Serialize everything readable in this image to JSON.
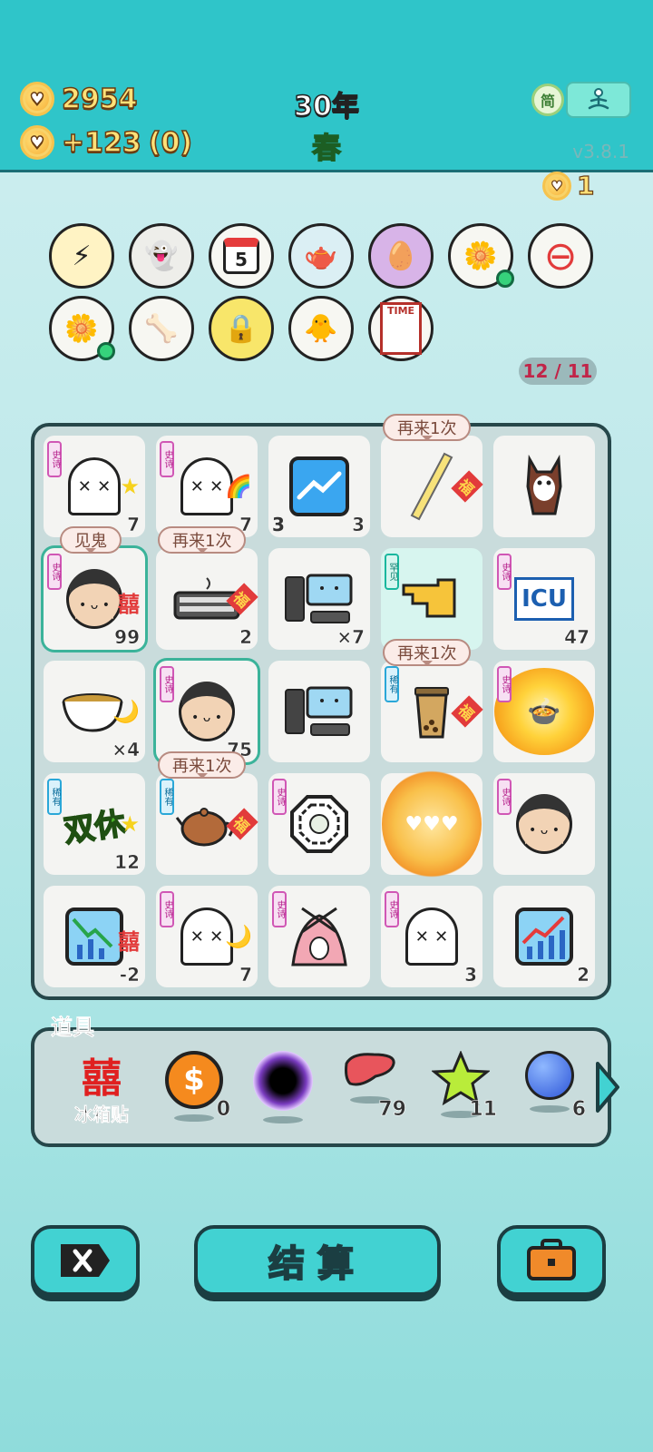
{
  "header": {
    "coins": "2954",
    "income": "+123",
    "income_pending": "(0)",
    "year": "30年",
    "season": "春",
    "version": "v3.8.1",
    "lang_label": "简"
  },
  "mini_coin": "1",
  "board_counter": "12 / 11",
  "buffs": [
    {
      "name": "lightning-icon",
      "glyph": "⚡"
    },
    {
      "name": "ghost-icon",
      "glyph": "👻"
    },
    {
      "name": "calendar-icon",
      "glyph": "5"
    },
    {
      "name": "gravy-boat-icon",
      "glyph": "🫖"
    },
    {
      "name": "egg-bag-icon",
      "glyph": "🥚"
    },
    {
      "name": "flower-pot-icon",
      "glyph": "🌼"
    },
    {
      "name": "minus-icon",
      "glyph": "⊖"
    },
    {
      "name": "flower-pot-icon-2",
      "glyph": "🌼"
    },
    {
      "name": "dog-bowl-icon",
      "glyph": "🦴"
    },
    {
      "name": "safe-icon",
      "glyph": "🔒"
    },
    {
      "name": "chick-syringe-icon",
      "glyph": "🐥"
    },
    {
      "name": "time-magazine-icon",
      "glyph": "TIME"
    }
  ],
  "tags": {
    "epic": "史诗",
    "rare": "稀有",
    "uncommon": "罕见"
  },
  "board": [
    {
      "icon": "ghost",
      "extra": "★",
      "tag": "epic",
      "num": "7"
    },
    {
      "icon": "ghost",
      "extra": "🌈",
      "tag": "epic",
      "num": "7"
    },
    {
      "icon": "chart-up",
      "numLeft": "3",
      "num": "3"
    },
    {
      "icon": "straw",
      "extra": "福",
      "bubble": "再来1次"
    },
    {
      "icon": "husky"
    },
    {
      "icon": "face",
      "extra": "囍",
      "tag": "epic",
      "num": "99",
      "bubble": "见鬼",
      "selected": true
    },
    {
      "icon": "keyboard",
      "extra": "福",
      "num": "2",
      "bubble": "再来1次"
    },
    {
      "icon": "computer",
      "num": "×7"
    },
    {
      "icon": "hand",
      "tag": "uncommon",
      "highlight": true
    },
    {
      "icon": "icu",
      "tag": "epic",
      "num": "47"
    },
    {
      "icon": "tea-bowl",
      "extra": "🌙",
      "num": "×4"
    },
    {
      "icon": "face",
      "tag": "epic",
      "num": "75",
      "selected": true
    },
    {
      "icon": "computer"
    },
    {
      "icon": "bubble-tea",
      "extra": "福",
      "tag": "rare",
      "bubble": "再来1次"
    },
    {
      "icon": "pot-explosion",
      "tag": "epic"
    },
    {
      "icon": "double-holiday",
      "extra": "★",
      "tag": "rare",
      "num": "12"
    },
    {
      "icon": "teapot",
      "extra": "福",
      "tag": "rare",
      "bubble": "再来1次"
    },
    {
      "icon": "bagua",
      "tag": "epic"
    },
    {
      "icon": "coin-burst"
    },
    {
      "icon": "face",
      "tag": "epic"
    },
    {
      "icon": "chart-down",
      "extra": "囍",
      "num": "-2"
    },
    {
      "icon": "ghost",
      "extra": "🌙",
      "tag": "epic",
      "num": "7"
    },
    {
      "icon": "rabbit-tent",
      "tag": "epic"
    },
    {
      "icon": "ghost",
      "tag": "epic",
      "num": "3"
    },
    {
      "icon": "chart-up-red",
      "num": "2"
    }
  ],
  "labels": {
    "icu": "ICU",
    "double_holiday": "双休",
    "time": "TIME"
  },
  "items": {
    "title": "道具",
    "fridge_sticker_label": "冰箱贴",
    "fridge_glyph": "囍",
    "list": [
      {
        "name": "dollar-coin-icon",
        "glyph": "$",
        "count": "0"
      },
      {
        "name": "black-hole-icon",
        "glyph": "●",
        "count": ""
      },
      {
        "name": "liver-icon",
        "glyph": "",
        "count": "79"
      },
      {
        "name": "star-icon",
        "glyph": "★",
        "count": "11"
      },
      {
        "name": "blueberry-icon",
        "glyph": "",
        "count": "6"
      }
    ]
  },
  "buttons": {
    "settle": "结算"
  }
}
